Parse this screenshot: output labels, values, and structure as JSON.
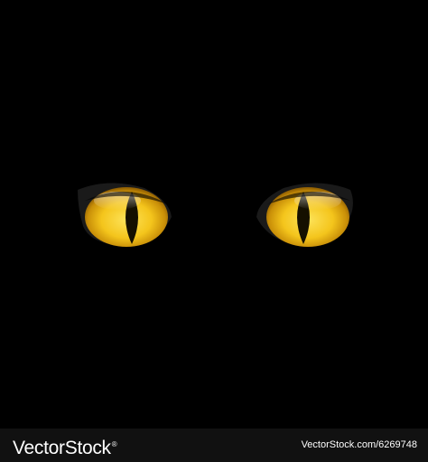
{
  "scene": {
    "background": "#000000",
    "eye_color": "#f2c21a",
    "pupil_color": "#151000"
  },
  "footer": {
    "brand_main": "VectorStock",
    "brand_reg": "®",
    "image_ref": "VectorStock.com/6269748",
    "background": "#111111"
  }
}
